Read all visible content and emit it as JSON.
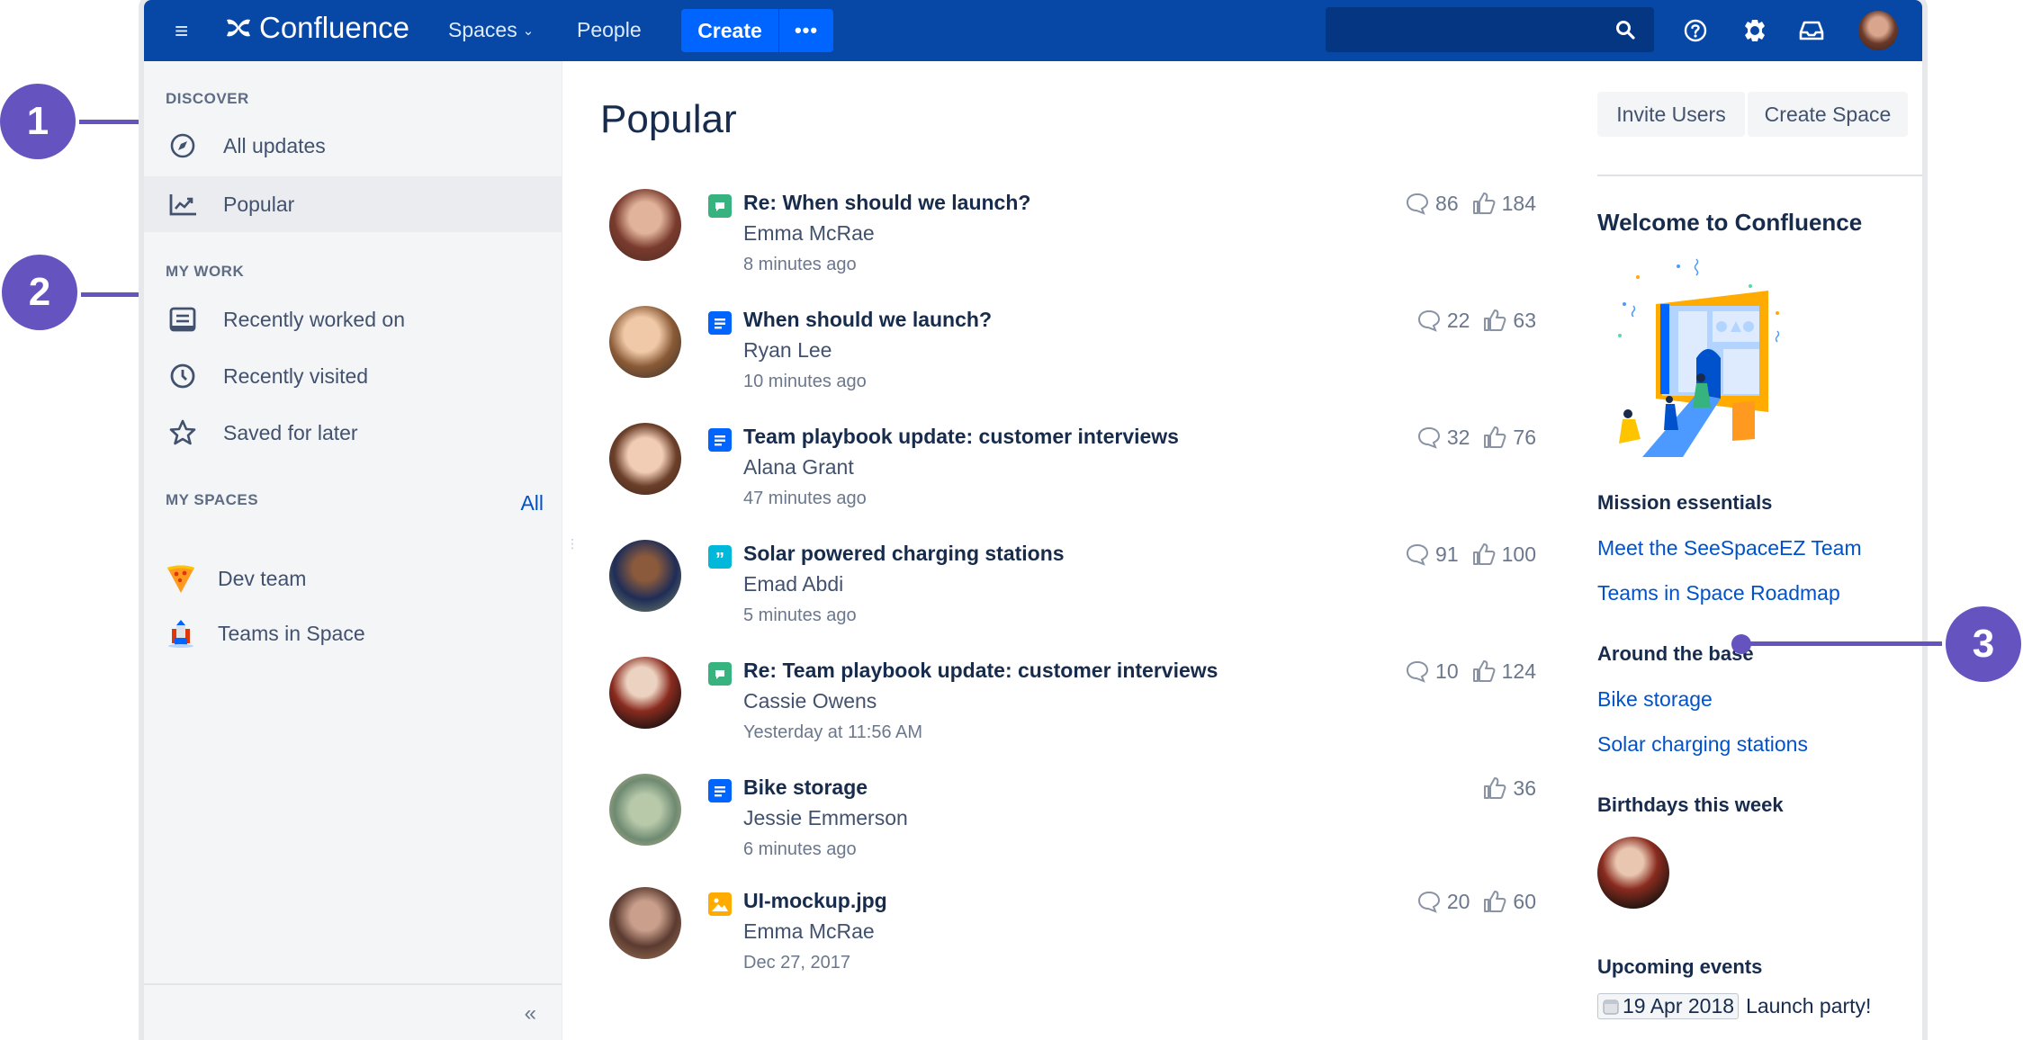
{
  "app": {
    "name": "Confluence",
    "brand_color": "#0747A6",
    "accent_color": "#0065FF"
  },
  "topnav": {
    "menu_icon": "hamburger-icon",
    "logo_icon": "confluence-logo-icon",
    "logo_text": "Confluence",
    "spaces_label": "Spaces",
    "people_label": "People",
    "create_label": "Create",
    "more_label": "•••",
    "search_placeholder": "",
    "icons": [
      "search-icon",
      "help-icon",
      "gear-icon",
      "notifications-inbox-icon",
      "user-avatar"
    ]
  },
  "sidebar": {
    "discover_title": "DISCOVER",
    "discover_items": [
      {
        "label": "All updates",
        "icon": "compass-icon",
        "active": false
      },
      {
        "label": "Popular",
        "icon": "trending-chart-icon",
        "active": true
      }
    ],
    "mywork_title": "MY WORK",
    "mywork_items": [
      {
        "label": "Recently worked on",
        "icon": "document-list-icon"
      },
      {
        "label": "Recently visited",
        "icon": "clock-icon"
      },
      {
        "label": "Saved for later",
        "icon": "star-icon"
      }
    ],
    "myspaces_title": "MY SPACES",
    "all_link": "All",
    "spaces": [
      {
        "label": "Dev team",
        "icon": "pizza-space-icon"
      },
      {
        "label": "Teams in Space",
        "icon": "rocket-space-icon"
      }
    ],
    "collapse_label": "«"
  },
  "main": {
    "title": "Popular",
    "feed": [
      {
        "title": "Re: When should we launch?",
        "author": "Emma McRae",
        "time": "8 minutes ago",
        "type": "comment",
        "type_color": "#36B37E",
        "comments": "86",
        "likes": "184"
      },
      {
        "title": "When should we launch?",
        "author": "Ryan Lee",
        "time": "10 minutes ago",
        "type": "page",
        "type_color": "#0065FF",
        "comments": "22",
        "likes": "63"
      },
      {
        "title": "Team playbook update: customer interviews",
        "author": "Alana Grant",
        "time": "47 minutes ago",
        "type": "page",
        "type_color": "#0065FF",
        "comments": "32",
        "likes": "76"
      },
      {
        "title": "Solar powered charging stations",
        "author": "Emad Abdi",
        "time": "5 minutes ago",
        "type": "quote",
        "type_color": "#00B8D9",
        "comments": "91",
        "likes": "100"
      },
      {
        "title": "Re: Team playbook update: customer interviews",
        "author": "Cassie Owens",
        "time": "Yesterday at 11:56 AM",
        "type": "comment",
        "type_color": "#36B37E",
        "comments": "10",
        "likes": "124"
      },
      {
        "title": "Bike storage",
        "author": "Jessie Emmerson",
        "time": "6 minutes ago",
        "type": "page",
        "type_color": "#0065FF",
        "comments": null,
        "likes": "36"
      },
      {
        "title": "UI-mockup.jpg",
        "author": "Emma McRae",
        "time": "Dec 27, 2017",
        "type": "image",
        "type_color": "#FFAB00",
        "comments": "20",
        "likes": "60"
      }
    ]
  },
  "right": {
    "invite_label": "Invite Users",
    "create_space_label": "Create Space",
    "welcome_title": "Welcome to Confluence",
    "mission_title": "Mission essentials",
    "mission_links": [
      "Meet the SeeSpaceEZ Team",
      "Teams in Space Roadmap"
    ],
    "base_title": "Around the base",
    "base_links": [
      "Bike storage",
      "Solar charging stations"
    ],
    "birthdays_title": "Birthdays this week",
    "events_title": "Upcoming events",
    "event_date": "19 Apr 2018",
    "event_name": "Launch party!"
  },
  "annotations": {
    "color": "#6554C0",
    "labels": [
      "1",
      "2",
      "3"
    ]
  }
}
